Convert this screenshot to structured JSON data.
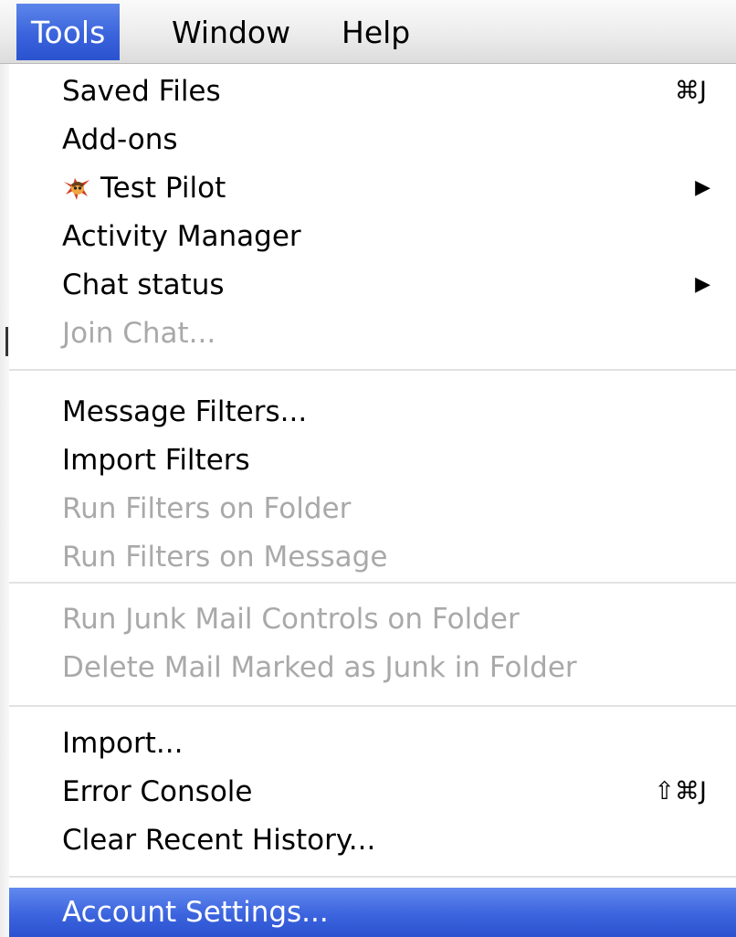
{
  "menubar": {
    "items": [
      {
        "label": "Tools",
        "active": true
      },
      {
        "label": "Window",
        "active": false
      },
      {
        "label": "Help",
        "active": false
      }
    ]
  },
  "menu": {
    "groups": [
      [
        {
          "label": "Saved Files",
          "shortcut": "⌘J",
          "enabled": true
        },
        {
          "label": "Add-ons",
          "enabled": true
        },
        {
          "label": "Test Pilot",
          "icon": "test-pilot-icon",
          "submenu": true,
          "enabled": true
        },
        {
          "label": "Activity Manager",
          "enabled": true
        },
        {
          "label": "Chat status",
          "submenu": true,
          "enabled": true
        },
        {
          "label": "Join Chat...",
          "enabled": false
        }
      ],
      [
        {
          "label": "Message Filters...",
          "enabled": true
        },
        {
          "label": "Import Filters",
          "enabled": true
        },
        {
          "label": "Run Filters on Folder",
          "enabled": false
        },
        {
          "label": "Run Filters on Message",
          "enabled": false
        }
      ],
      [
        {
          "label": "Run Junk Mail Controls on Folder",
          "enabled": false
        },
        {
          "label": "Delete Mail Marked as Junk in Folder",
          "enabled": false
        }
      ],
      [
        {
          "label": "Import...",
          "enabled": true
        },
        {
          "label": "Error Console",
          "shortcut": "⇧⌘J",
          "enabled": true
        },
        {
          "label": "Clear Recent History...",
          "enabled": true
        }
      ],
      [
        {
          "label": "Account Settings...",
          "enabled": true,
          "highlighted": true
        }
      ]
    ],
    "submenu_arrow": "▶"
  },
  "colors": {
    "highlight": "#3c64de",
    "disabled_text": "#a9a9a9",
    "separator": "#e2e2e2"
  }
}
